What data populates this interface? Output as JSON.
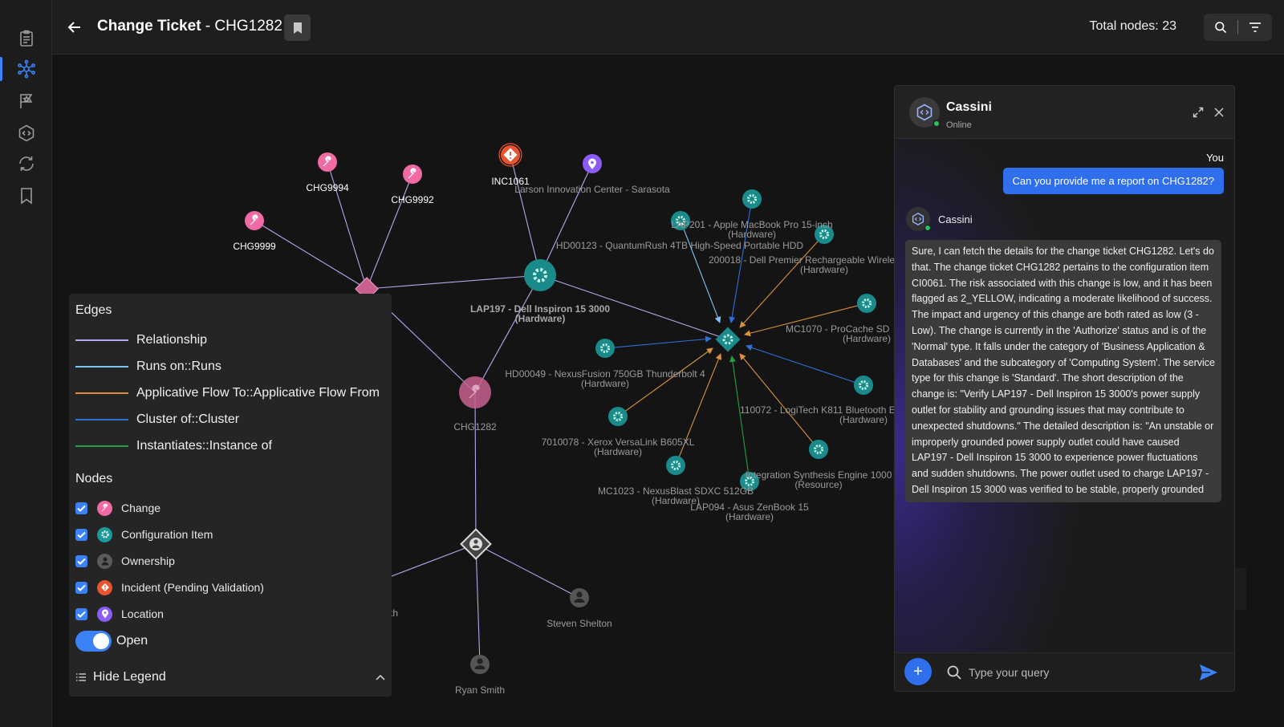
{
  "header": {
    "title_bold": "Change Ticket",
    "title_rest": " - CHG1282",
    "total_nodes": "Total nodes: 23"
  },
  "rail": {
    "icons": [
      "clipboard-icon",
      "network-icon",
      "star-flag-icon",
      "hexagon-code-icon",
      "refresh-icon",
      "bookmark-icon"
    ],
    "active_index": 1
  },
  "graph": {
    "node_labels": {
      "chg9994": "CHG9994",
      "chg9992": "CHG9992",
      "chg9999": "CHG9999",
      "inc1061": "INC1061",
      "larson": "Larson Innovation Center - Sarasota",
      "lap197_1": "LAP197 - Dell Inspiron 15 3000",
      "lap197_2": "(Hardware)",
      "chg1282": "CHG1282",
      "lap201_1": "LAP201 - Apple MacBook Pro 15-inch",
      "lap201_2": "(Hardware)",
      "hd00123": "HD00123 - QuantumRush 4TB High-Speed Portable HDD",
      "n200018_1": "200018 - Dell Premier Rechargeable Wirele",
      "n200018_2": "(Hardware)",
      "mc1070_1": "MC1070 - ProCache SD",
      "mc1070_2": "(Hardware)",
      "hd00049_1": "HD00049 - NexusFusion 750GB Thunderbolt 4",
      "hd00049_2": "(Hardware)",
      "n110072_1": "110072 - LogiTech K811 Bluetooth E",
      "n110072_2": "(Hardware)",
      "n7010078_1": "7010078 - Xerox VersaLink B605XL",
      "n7010078_2": "(Hardware)",
      "integration_1": "Integration Synthesis Engine 1000",
      "integration_2": "(Resource)",
      "mc1023_1": "MC1023 - NexusBlast SDXC 512GB",
      "mc1023_2": "(Hardware)",
      "lap094_1": "LAP094 - Asus ZenBook 15",
      "lap094_2": "(Hardware)",
      "steven": "Steven Shelton",
      "ryan": "Ryan Smith",
      "partial_th": "th"
    }
  },
  "legend": {
    "edges_title": "Edges",
    "edges": [
      {
        "label": "Relationship",
        "color": "#b9a5f0"
      },
      {
        "label": "Runs on::Runs",
        "color": "#7cc4f2"
      },
      {
        "label": "Applicative Flow To::Applicative Flow From",
        "color": "#d8923f"
      },
      {
        "label": "Cluster of::Cluster",
        "color": "#2f6fd8"
      },
      {
        "label": "Instantiates::Instance of",
        "color": "#22a043"
      }
    ],
    "nodes_title": "Nodes",
    "nodes": [
      {
        "label": "Change",
        "color": "#f06aa3",
        "icon": "wrench-icon"
      },
      {
        "label": "Configuration Item",
        "color": "#1a9b9b",
        "icon": "gear-icon"
      },
      {
        "label": "Ownership",
        "color": "#5a5a5a",
        "icon": "person-icon"
      },
      {
        "label": "Incident (Pending Validation)",
        "color": "#e8542f",
        "icon": "alert-icon"
      },
      {
        "label": "Location",
        "color": "#8b5cf6",
        "icon": "pin-icon"
      }
    ],
    "toggle_label": "Open",
    "hide_label": "Hide Legend"
  },
  "chat": {
    "name": "Cassini",
    "status": "Online",
    "you_label": "You",
    "user_message": "Can you provide me a report on CHG1282?",
    "bot_name": "Cassini",
    "bot_message": "Sure, I can fetch the details for the change ticket CHG1282. Let's do that. The change ticket CHG1282 pertains to the configuration item CI0061. The risk associated with this change is low, and it has been flagged as 2_YELLOW, indicating a moderate likelihood of success. The impact and urgency of this change are both rated as low (3 - Low). The change is currently in the 'Authorize' status and is of the 'Normal' type. It falls under the category of 'Business Application & Databases' and the subcategory of 'Computing System'. The service type for this change is 'Standard'. The short description of the change is: \"Verify LAP197 - Dell Inspiron 15 3000's power supply outlet for stability and grounding issues that may contribute to unexpected shutdowns.\" The detailed description is: \"An unstable or improperly grounded power supply outlet could have caused LAP197 - Dell Inspiron 15 3000 to experience power fluctuations and sudden shutdowns. The power outlet used to charge LAP197 - Dell Inspiron 15 3000 was verified to be stable, properly grounded",
    "input_placeholder": "Type your query",
    "add_label": "+"
  }
}
